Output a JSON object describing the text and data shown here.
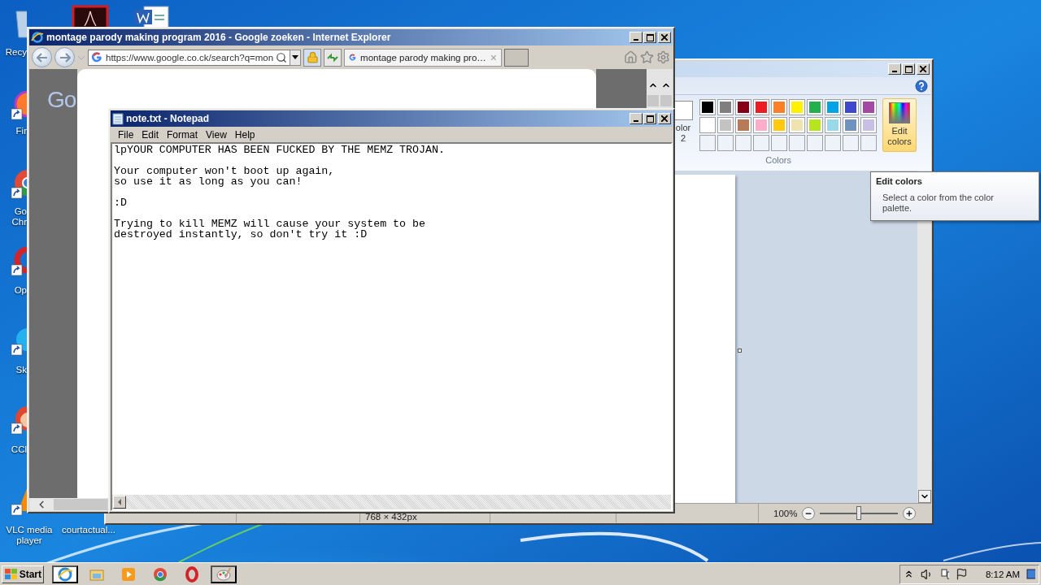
{
  "desktop": {
    "top_icons": [
      {
        "kind": "pdf"
      },
      {
        "kind": "word"
      }
    ],
    "icons": [
      {
        "kind": "recycle_bin",
        "label": "Recy"
      },
      {
        "kind": "firefox",
        "label": "Fir"
      },
      {
        "kind": "chrome",
        "label": "Go Chr"
      },
      {
        "kind": "opera",
        "label": "Op"
      },
      {
        "kind": "skype",
        "label": "Sk"
      },
      {
        "kind": "ccleaner",
        "label": "CCl"
      },
      {
        "kind": "vlc",
        "label": "VLC media player"
      },
      {
        "kind": "file",
        "label": "courtactual..."
      }
    ]
  },
  "paint": {
    "color2_label": "olor 2",
    "palette": [
      {
        "kind": "swatch",
        "color": "#000000"
      },
      {
        "kind": "swatch",
        "color": "#7f7f7f"
      },
      {
        "kind": "swatch",
        "color": "#880015"
      },
      {
        "kind": "swatch",
        "color": "#ed1c24"
      },
      {
        "kind": "swatch",
        "color": "#ff7f27"
      },
      {
        "kind": "swatch",
        "color": "#fff200"
      },
      {
        "kind": "swatch",
        "color": "#22b14c"
      },
      {
        "kind": "swatch",
        "color": "#00a2e8"
      },
      {
        "kind": "swatch",
        "color": "#3f48cc"
      },
      {
        "kind": "swatch",
        "color": "#a349a4"
      },
      {
        "kind": "swatch",
        "color": "#ffffff"
      },
      {
        "kind": "swatch",
        "color": "#c3c3c3"
      },
      {
        "kind": "swatch",
        "color": "#b97a57"
      },
      {
        "kind": "swatch",
        "color": "#ffaec9"
      },
      {
        "kind": "swatch",
        "color": "#ffc90e"
      },
      {
        "kind": "swatch",
        "color": "#efe4b0"
      },
      {
        "kind": "swatch",
        "color": "#b5e61d"
      },
      {
        "kind": "swatch",
        "color": "#99d9ea"
      },
      {
        "kind": "swatch",
        "color": "#7092be"
      },
      {
        "kind": "swatch",
        "color": "#c8bfe7"
      },
      {
        "kind": "empty"
      },
      {
        "kind": "empty"
      },
      {
        "kind": "empty"
      },
      {
        "kind": "empty"
      },
      {
        "kind": "empty"
      },
      {
        "kind": "empty"
      },
      {
        "kind": "empty"
      },
      {
        "kind": "empty"
      },
      {
        "kind": "empty"
      },
      {
        "kind": "empty"
      }
    ],
    "edit_colors": {
      "label": "Edit colors",
      "highlighted": true
    },
    "group_label": "Colors",
    "status": {
      "image_size": "768 × 432px",
      "zoom": "100%",
      "zoom_slider": {
        "level": 0.5
      }
    }
  },
  "browser": {
    "title": "montage parody making program 2016 - Google zoeken - Internet Explorer",
    "address": "https://www.google.co.ck/search?q=mon",
    "tab": {
      "title": "montage parody making pro…",
      "close": "×"
    },
    "page_logo": "Go"
  },
  "notepad": {
    "title": "note.txt - Notepad",
    "menu": [
      "File",
      "Edit",
      "Format",
      "View",
      "Help"
    ],
    "text": "lpYOUR COMPUTER HAS BEEN FUCKED BY THE MEMZ TROJAN.\n\nYour computer won't boot up again,\nso use it as long as you can!\n\n:D\n\nTrying to kill MEMZ will cause your system to be\ndestroyed instantly, so don't try it :D"
  },
  "tooltip": {
    "title": "Edit colors",
    "body": "Select a color from the color palette."
  },
  "taskbar": {
    "start": "Start",
    "apps": [
      {
        "kind": "ie",
        "selected": true
      },
      {
        "kind": "explorer",
        "selected": false
      },
      {
        "kind": "media",
        "selected": false
      },
      {
        "kind": "chrome",
        "selected": false
      },
      {
        "kind": "opera",
        "selected": false
      },
      {
        "kind": "paint",
        "selected": false
      }
    ],
    "clock": "8:12 AM"
  }
}
